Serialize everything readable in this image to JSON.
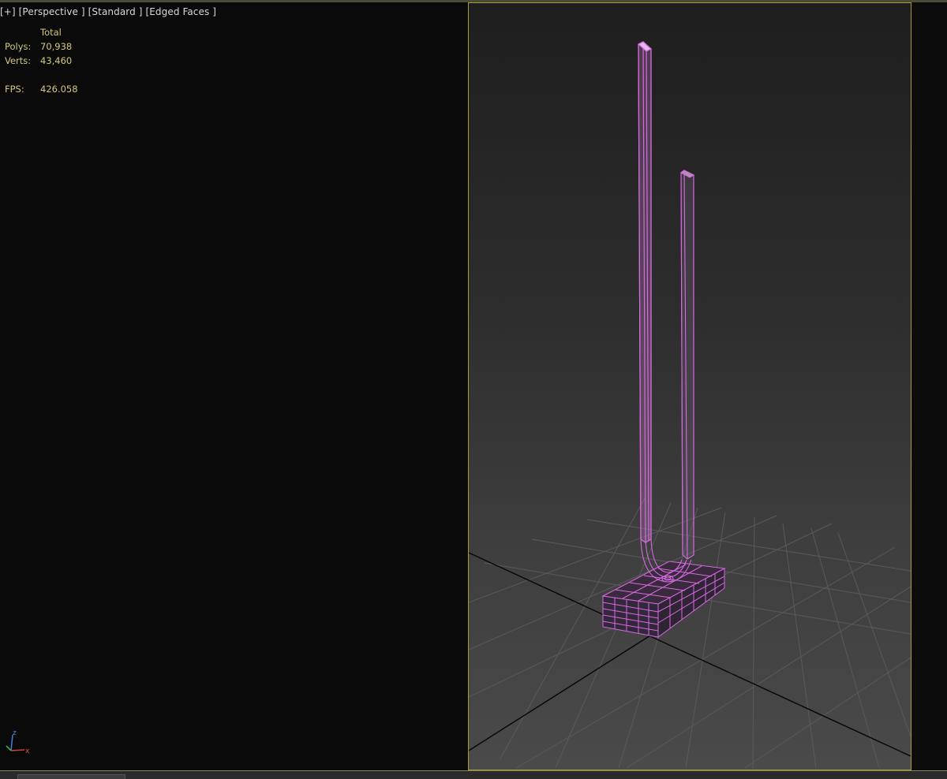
{
  "viewport": {
    "labels": [
      "[+]",
      "[Perspective ]",
      "[Standard ]",
      "[Edged Faces ]"
    ]
  },
  "stats": {
    "header": "Total",
    "polys_label": "Polys:",
    "polys_value": "70,938",
    "verts_label": "Verts:",
    "verts_value": "43,460",
    "fps_label": "FPS:",
    "fps_value": "426.058"
  },
  "axis": {
    "z": "z",
    "x": "x"
  },
  "colors": {
    "wire": "#d66ae0",
    "stat_text": "#d4c878",
    "viewport_border": "#a89a38",
    "grid": "#5a5a5a"
  }
}
